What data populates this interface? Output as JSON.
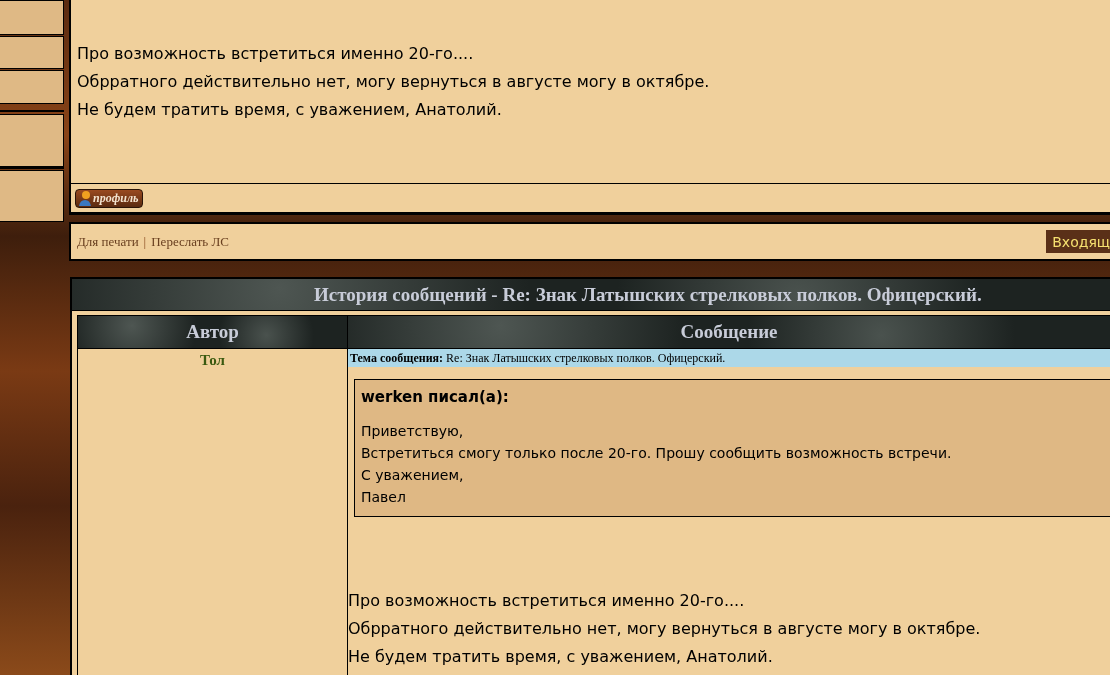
{
  "post": {
    "lines": [
      "Про возможность встретиться именно 20-го....",
      "Обрратного действительно нет, могу вернуться в августе могу в октябре.",
      "Не будем тратить время, с уважением, Анатолий."
    ],
    "profile_button": "профиль"
  },
  "links_bar": {
    "separator": "|",
    "links": [
      "Для печати",
      "Переслать ЛС"
    ],
    "inbox_button": "Входящ"
  },
  "history": {
    "title": "История сообщений - Re: Знак Латышских стрелковых полков. Офицерский.",
    "columns": [
      "Автор",
      "Сообщение"
    ],
    "rows": [
      {
        "author": "Тол",
        "subject": "**Тема сообщения:** Re: Знак Латышских стрелковых полков. Офицерский.",
        "quote": {
          "header": "werken писал(а):",
          "lines": [
            "Приветствую,",
            "Встретиться смогу только после 20-го. Прошу сообщить возможность встречи.",
            "С уважением,",
            "Павел"
          ]
        },
        "lines": [
          "Про возможность встретиться именно 20-го....",
          "Обрратного действительно нет, могу вернуться в августе могу в октябре.",
          "Не будем тратить время, с уважением, Анатолий."
        ]
      }
    ]
  }
}
